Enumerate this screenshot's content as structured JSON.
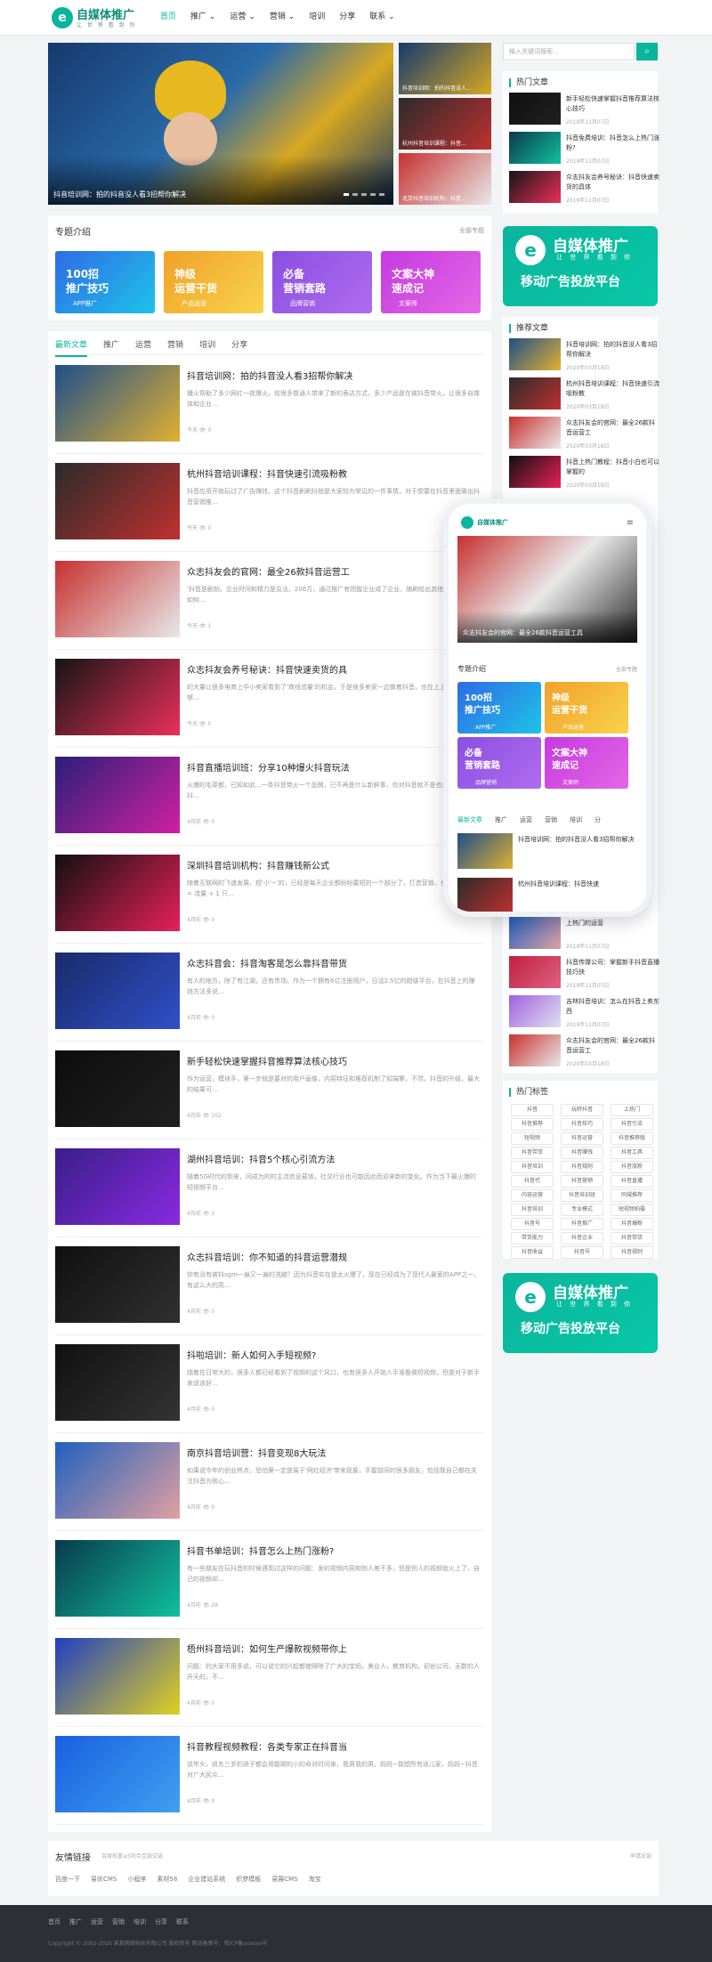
{
  "header": {
    "logo_mark": "e",
    "logo_title": "自媒体推广",
    "logo_sub": "让 世 界 看 到 你",
    "nav": [
      "首页",
      "推广",
      "运营",
      "营销",
      "培训",
      "分享",
      "联系"
    ],
    "nav_arrows": [
      "",
      "⌄",
      "⌄",
      "⌄",
      "",
      "",
      "⌄"
    ]
  },
  "search": {
    "placeholder": "输入关键词搜索...",
    "button_icon": "search-icon"
  },
  "slider": {
    "main_caption": "抖音培训网：拍的抖音没人看3招帮你解决",
    "side": [
      "抖音培训网：拍的抖音没人...",
      "杭州抖音培训课程：抖音...",
      "北京抖音培训机构：抖音..."
    ]
  },
  "topics": {
    "title": "专题介绍",
    "more": "全部专题",
    "items": [
      {
        "a": "100招\n推广技巧",
        "b": "APP推广",
        "c1": "#2f6be6",
        "c2": "#1ec3e8"
      },
      {
        "a": "神级\n运营干货",
        "b": "产品运营",
        "c1": "#f2a12a",
        "c2": "#f7d34b"
      },
      {
        "a": "必备\n营销套路",
        "b": "品牌营销",
        "c1": "#8a4fe0",
        "c2": "#b06cf0"
      },
      {
        "a": "文案大神\n速成记",
        "b": "文案师",
        "c1": "#c43ae0",
        "c2": "#e568e5"
      }
    ]
  },
  "article_tabs": [
    "最新文章",
    "推广",
    "运营",
    "营销",
    "培训",
    "分享"
  ],
  "articles": [
    {
      "title": "抖音培训网：拍的抖音没人看3招帮你解决",
      "desc": "播火帮助了多少网红一夜爆火，给很多普通人带来了新的表达方式，多少产品是在被抖音带火，让很多自媒体和企业...",
      "time": "今天",
      "views": "0",
      "c1": "#1f4f8a",
      "c2": "#e0b030"
    },
    {
      "title": "杭州抖音培训课程：抖音快速引流吸粉教",
      "desc": "抖音应用开始玩过了广告赚钱，这个抖音刷刷抖就是大家较为常见的一件事情，对于想要在抖音里面做出抖音营销推...",
      "time": "今天",
      "views": "0",
      "c1": "#2b2b2b",
      "c2": "#c03030"
    },
    {
      "title": "众志抖友会的官网：最全26款抖音运营工",
      "desc": "'抖音是剧刻，企业时间和精力是及法，206万，通过推广有把握企业成了企业，随刷给出其他个有些也能如何...",
      "time": "今天",
      "views": "1",
      "c1": "#c83030",
      "c2": "#e8e8e8"
    },
    {
      "title": "众志抖友会养号秘诀：抖音快速卖货的具",
      "desc": "的大量让很多电商上中小卖家看到了'商线流量'的机会，于是很多卖家一边做着抖音，也在上上升，希望能够...",
      "time": "今天",
      "views": "5",
      "c1": "#151515",
      "c2": "#ec2f5a"
    },
    {
      "title": "抖音直播培训班：分享10种爆火抖音玩法",
      "desc": "火爆的毛菜都，已知如此...一条抖音带火一个品牌，已不再是什么新鲜事，你对抖音就不是也想法也会去抖...",
      "time": "4月前",
      "views": "0",
      "c1": "#2b1f7a",
      "c2": "#d020a0"
    },
    {
      "title": "深圳抖音培训机构：抖音赚钱新公式",
      "desc": "随着互联网的飞速发展，短'小'~'的，已经是每天企业都纷纷要短的一个部分了，打造营销，也是在和，线 = 流量 + 1 只...",
      "time": "4月前",
      "views": "0",
      "c1": "#101010",
      "c2": "#e8205a"
    },
    {
      "title": "众志抖音会：抖音淘客是怎么靠抖音带货",
      "desc": "有人的地方，除了有江湖，还有市场。作为一个拥有6亿注册用户，日活2.5亿的超级平台，在抖音上的赚钱方法多说...",
      "time": "4月前",
      "views": "0",
      "c1": "#1a2a6a",
      "c2": "#3050c8"
    },
    {
      "title": "新手轻松快速掌握抖音推荐算法核心技巧",
      "desc": "作为运营，模块手，第一步就是要对的用户画像，内容特征和推荐机制了知端擎，不然，抖音的升级，最大的结果可...",
      "time": "4月前",
      "views": "102",
      "c1": "#0d0d0d",
      "c2": "#202020"
    },
    {
      "title": "湖州抖音培训：抖音5个核心引流方法",
      "desc": "随着5G时代的到来，间成为的的主流信息载体，社交行业也可能因此而迎来新的变化。作为当下最火爆的短视频平台...",
      "time": "4月前",
      "views": "3",
      "c1": "#3a1e8a",
      "c2": "#8a2ae0"
    },
    {
      "title": "众志抖音培训：你不知道的抖音运营潜规",
      "desc": "你有没有被抖sgm一遍又一遍的洗脑？因为抖音实在是太火爆了，现在已经成为了现代人最爱的APP之一，有这么大的高...",
      "time": "4月前",
      "views": "0",
      "c1": "#101010",
      "c2": "#303030"
    },
    {
      "title": "抖啦培训：新人如何入手短视频?",
      "desc": "随着在日常大的，很多人都已经看到了视频的这个风口，也有很多人开始入手准备做短视频，但是对于新手来说该好...",
      "time": "4月前",
      "views": "0",
      "c1": "#111",
      "c2": "#333"
    },
    {
      "title": "南京抖音培训营：抖音变现8大玩法",
      "desc": "如果说今年的创业热点，恐怕第一定是属于'网红经济'带来现象，手握前同的很多朋友，包括我自己都在关注抖音为核心...",
      "time": "4月前",
      "views": "0",
      "c1": "#2060c0",
      "c2": "#e0a0a0"
    },
    {
      "title": "抖音书单培训：抖音怎么上热门涨粉?",
      "desc": "有一些朋友在玩抖音的时候遇到过这样的问题：发的视频内容和别人差不多，但是别人的视频就火上了，自己的视频却...",
      "time": "4月前",
      "views": "28",
      "c1": "#0a3a4a",
      "c2": "#10c0a0"
    },
    {
      "title": "梧州抖音培训：如何生产爆款视频带你上",
      "desc": "问题：的大家不用多说，可以说它的兴起都使得除了广大的宝妈，美业人，教育机构，初创公司，无数的人开天的，不...",
      "time": "4月前",
      "views": "0",
      "c1": "#2040c0",
      "c2": "#e0d020"
    },
    {
      "title": "抖音教程视频教程：各类专家正在抖音当",
      "desc": "说年头，凯东三岁的孩子都会用能聊的小的命对时间来，我男我的男，妈妈~我想所有适儿家，妈妈~抖音对广大民众...",
      "time": "4月前",
      "views": "0",
      "c1": "#1a60e0",
      "c2": "#40a0f0"
    }
  ],
  "sidebar": {
    "hot_title": "热门文章",
    "hot": [
      {
        "title": "新手轻松快速掌握抖音推荐算法核心技巧",
        "time": "2019年11月07日",
        "c1": "#101010",
        "c2": "#202020"
      },
      {
        "title": "抖音免费培训：抖音怎么上热门涨粉?",
        "time": "2019年11月07日",
        "c1": "#0a3a4a",
        "c2": "#10c0a0"
      },
      {
        "title": "众志抖友会养号秘诀：抖音快速卖货的具体",
        "time": "2019年11月07日",
        "c1": "#151515",
        "c2": "#ec2f5a"
      }
    ],
    "ad": {
      "mark": "e",
      "title": "自媒体推广",
      "sub": "让 世 界 看 到 你",
      "bottom": "移动广告投放平台"
    },
    "rec_title": "推荐文章",
    "rec": [
      {
        "title": "抖音培训网：拍的抖音没人看3招帮你解决",
        "time": "2020年03月18日",
        "c1": "#1f4f8a",
        "c2": "#e0b030"
      },
      {
        "title": "杭州抖音培训课程：抖音快速引流吸粉教",
        "time": "2020年03月18日",
        "c1": "#2b2b2b",
        "c2": "#c03030"
      },
      {
        "title": "众志抖友会的官网：最全26款抖音运营工",
        "time": "2020年03月18日",
        "c1": "#c83030",
        "c2": "#e8e8e8"
      },
      {
        "title": "抖音上热门教程：抖音小白也可以掌握的",
        "time": "2020年03月18日",
        "c1": "#101010",
        "c2": "#e8205a"
      }
    ],
    "rec2": [
      {
        "title": "上热门的运营",
        "time": "2019年11月07日",
        "c1": "#2060c0",
        "c2": "#e0a0a0"
      },
      {
        "title": "抖音传媒公司：掌握新手抖音直播技巧快",
        "time": "2019年11月07日",
        "c1": "#c02040",
        "c2": "#e06080"
      },
      {
        "title": "吉林抖音培训：怎么在抖音上卖东西",
        "time": "2019年11月07日",
        "c1": "#a060e0",
        "c2": "#e0e0f0"
      },
      {
        "title": "众志抖友会的官网：最全26款抖音运营工",
        "time": "2020年03月18日",
        "c1": "#c83030",
        "c2": "#e8e8e8"
      }
    ],
    "tags_title": "热门标签",
    "tags": [
      "抖音",
      "玩转抖音",
      "上热门",
      "抖音推荐",
      "抖音技巧",
      "抖音引流",
      "短视频",
      "抖音运营",
      "抖音推荐版",
      "抖音带货",
      "抖音赚钱",
      "抖音工具",
      "抖音培训",
      "抖音规则",
      "抖音涨粉",
      "抖音代",
      "抖音营销",
      "抖音直播",
      "内容运营",
      "抖音培训班",
      "同城推荐",
      "抖音培训",
      "专业模式",
      "短视频拍摄",
      "抖音号",
      "抖音推广",
      "抖音爆粉",
      "带货能力",
      "抖音企业",
      "抖音带货",
      "抖音收益",
      "抖音号",
      "抖音规则"
    ]
  },
  "phone": {
    "logo": "自媒体推广",
    "slide_caption": "众志抖友会的官网：最全26款抖音运营工具",
    "topics_title": "专题介绍",
    "topics_more": "全部专题",
    "tabs": [
      "最新文章",
      "推广",
      "运营",
      "营销",
      "培训",
      "分"
    ],
    "items": [
      {
        "title": "抖音培训网：拍的抖音没人看3招帮你解决",
        "c1": "#1f4f8a",
        "c2": "#e0b030"
      },
      {
        "title": "杭州抖音培训课程：抖音快速",
        "c1": "#2b2b2b",
        "c2": "#c03030"
      }
    ]
  },
  "links": {
    "title": "友情链接",
    "note": "百度权重≥5符合互链交链",
    "apply": "申请友链",
    "items": [
      "百度一下",
      "易优CMS",
      "小程序",
      "素材58",
      "企业建站系统",
      "织梦模板",
      "易展CMS",
      "淘宝"
    ]
  },
  "footer": {
    "nav": [
      "首页",
      "推广",
      "运营",
      "营销",
      "培训",
      "分享",
      "联系"
    ],
    "copy": "Copyright © 2002-2020 某某网络科技有限公司 版权所有  网站备案号：粤ICP备xxxxxx号"
  }
}
